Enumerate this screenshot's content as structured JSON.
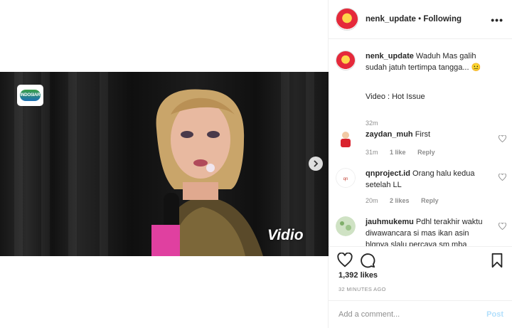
{
  "post": {
    "username": "nenk_update",
    "separator": "•",
    "follow_status": "Following",
    "more": "•••"
  },
  "media": {
    "channel_logo": "INDOSIAR",
    "watermark": "Vidio"
  },
  "caption": {
    "username": "nenk_update",
    "text": "Waduh Mas galih sudah jatuh tertimpa tangga...",
    "emoji": "😐",
    "line2": "Video : Hot Issue",
    "age": "32m"
  },
  "comments": [
    {
      "username": "zaydan_muh",
      "text": "First",
      "age": "31m",
      "likes": "1 like",
      "reply": "Reply"
    },
    {
      "username": "qnproject.id",
      "text": "Orang halu kedua setelah LL",
      "age": "20m",
      "likes": "2 likes",
      "reply": "Reply"
    },
    {
      "username": "jauhmukemu",
      "text": "Pdhl terakhir waktu diwawancara si mas ikan asin blgnya slalu percaya sm mba"
    }
  ],
  "likes_count": "1,392 likes",
  "timestamp": "32 MINUTES AGO",
  "add_comment": {
    "placeholder": "Add a comment...",
    "post_label": "Post"
  },
  "colors": {
    "text": "#262626",
    "muted": "#8e8e8e",
    "post_disabled": "#b2dffc",
    "border": "#efefef"
  },
  "icons": [
    "chevron-right-icon",
    "heart-icon",
    "comment-icon",
    "bookmark-icon"
  ]
}
